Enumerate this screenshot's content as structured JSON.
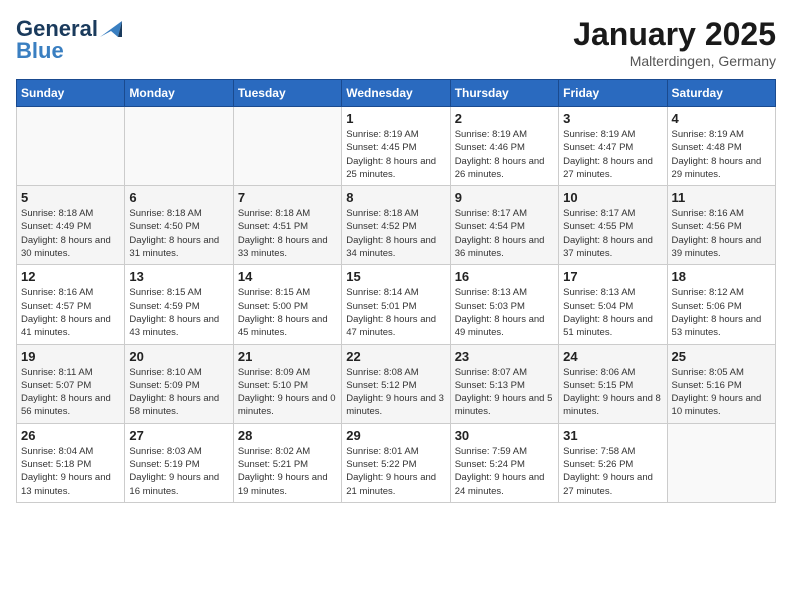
{
  "header": {
    "logo_line1": "General",
    "logo_line2": "Blue",
    "month_year": "January 2025",
    "location": "Malterdingen, Germany"
  },
  "days_of_week": [
    "Sunday",
    "Monday",
    "Tuesday",
    "Wednesday",
    "Thursday",
    "Friday",
    "Saturday"
  ],
  "weeks": [
    [
      {
        "day": "",
        "sunrise": "",
        "sunset": "",
        "daylight": ""
      },
      {
        "day": "",
        "sunrise": "",
        "sunset": "",
        "daylight": ""
      },
      {
        "day": "",
        "sunrise": "",
        "sunset": "",
        "daylight": ""
      },
      {
        "day": "1",
        "sunrise": "Sunrise: 8:19 AM",
        "sunset": "Sunset: 4:45 PM",
        "daylight": "Daylight: 8 hours and 25 minutes."
      },
      {
        "day": "2",
        "sunrise": "Sunrise: 8:19 AM",
        "sunset": "Sunset: 4:46 PM",
        "daylight": "Daylight: 8 hours and 26 minutes."
      },
      {
        "day": "3",
        "sunrise": "Sunrise: 8:19 AM",
        "sunset": "Sunset: 4:47 PM",
        "daylight": "Daylight: 8 hours and 27 minutes."
      },
      {
        "day": "4",
        "sunrise": "Sunrise: 8:19 AM",
        "sunset": "Sunset: 4:48 PM",
        "daylight": "Daylight: 8 hours and 29 minutes."
      }
    ],
    [
      {
        "day": "5",
        "sunrise": "Sunrise: 8:18 AM",
        "sunset": "Sunset: 4:49 PM",
        "daylight": "Daylight: 8 hours and 30 minutes."
      },
      {
        "day": "6",
        "sunrise": "Sunrise: 8:18 AM",
        "sunset": "Sunset: 4:50 PM",
        "daylight": "Daylight: 8 hours and 31 minutes."
      },
      {
        "day": "7",
        "sunrise": "Sunrise: 8:18 AM",
        "sunset": "Sunset: 4:51 PM",
        "daylight": "Daylight: 8 hours and 33 minutes."
      },
      {
        "day": "8",
        "sunrise": "Sunrise: 8:18 AM",
        "sunset": "Sunset: 4:52 PM",
        "daylight": "Daylight: 8 hours and 34 minutes."
      },
      {
        "day": "9",
        "sunrise": "Sunrise: 8:17 AM",
        "sunset": "Sunset: 4:54 PM",
        "daylight": "Daylight: 8 hours and 36 minutes."
      },
      {
        "day": "10",
        "sunrise": "Sunrise: 8:17 AM",
        "sunset": "Sunset: 4:55 PM",
        "daylight": "Daylight: 8 hours and 37 minutes."
      },
      {
        "day": "11",
        "sunrise": "Sunrise: 8:16 AM",
        "sunset": "Sunset: 4:56 PM",
        "daylight": "Daylight: 8 hours and 39 minutes."
      }
    ],
    [
      {
        "day": "12",
        "sunrise": "Sunrise: 8:16 AM",
        "sunset": "Sunset: 4:57 PM",
        "daylight": "Daylight: 8 hours and 41 minutes."
      },
      {
        "day": "13",
        "sunrise": "Sunrise: 8:15 AM",
        "sunset": "Sunset: 4:59 PM",
        "daylight": "Daylight: 8 hours and 43 minutes."
      },
      {
        "day": "14",
        "sunrise": "Sunrise: 8:15 AM",
        "sunset": "Sunset: 5:00 PM",
        "daylight": "Daylight: 8 hours and 45 minutes."
      },
      {
        "day": "15",
        "sunrise": "Sunrise: 8:14 AM",
        "sunset": "Sunset: 5:01 PM",
        "daylight": "Daylight: 8 hours and 47 minutes."
      },
      {
        "day": "16",
        "sunrise": "Sunrise: 8:13 AM",
        "sunset": "Sunset: 5:03 PM",
        "daylight": "Daylight: 8 hours and 49 minutes."
      },
      {
        "day": "17",
        "sunrise": "Sunrise: 8:13 AM",
        "sunset": "Sunset: 5:04 PM",
        "daylight": "Daylight: 8 hours and 51 minutes."
      },
      {
        "day": "18",
        "sunrise": "Sunrise: 8:12 AM",
        "sunset": "Sunset: 5:06 PM",
        "daylight": "Daylight: 8 hours and 53 minutes."
      }
    ],
    [
      {
        "day": "19",
        "sunrise": "Sunrise: 8:11 AM",
        "sunset": "Sunset: 5:07 PM",
        "daylight": "Daylight: 8 hours and 56 minutes."
      },
      {
        "day": "20",
        "sunrise": "Sunrise: 8:10 AM",
        "sunset": "Sunset: 5:09 PM",
        "daylight": "Daylight: 8 hours and 58 minutes."
      },
      {
        "day": "21",
        "sunrise": "Sunrise: 8:09 AM",
        "sunset": "Sunset: 5:10 PM",
        "daylight": "Daylight: 9 hours and 0 minutes."
      },
      {
        "day": "22",
        "sunrise": "Sunrise: 8:08 AM",
        "sunset": "Sunset: 5:12 PM",
        "daylight": "Daylight: 9 hours and 3 minutes."
      },
      {
        "day": "23",
        "sunrise": "Sunrise: 8:07 AM",
        "sunset": "Sunset: 5:13 PM",
        "daylight": "Daylight: 9 hours and 5 minutes."
      },
      {
        "day": "24",
        "sunrise": "Sunrise: 8:06 AM",
        "sunset": "Sunset: 5:15 PM",
        "daylight": "Daylight: 9 hours and 8 minutes."
      },
      {
        "day": "25",
        "sunrise": "Sunrise: 8:05 AM",
        "sunset": "Sunset: 5:16 PM",
        "daylight": "Daylight: 9 hours and 10 minutes."
      }
    ],
    [
      {
        "day": "26",
        "sunrise": "Sunrise: 8:04 AM",
        "sunset": "Sunset: 5:18 PM",
        "daylight": "Daylight: 9 hours and 13 minutes."
      },
      {
        "day": "27",
        "sunrise": "Sunrise: 8:03 AM",
        "sunset": "Sunset: 5:19 PM",
        "daylight": "Daylight: 9 hours and 16 minutes."
      },
      {
        "day": "28",
        "sunrise": "Sunrise: 8:02 AM",
        "sunset": "Sunset: 5:21 PM",
        "daylight": "Daylight: 9 hours and 19 minutes."
      },
      {
        "day": "29",
        "sunrise": "Sunrise: 8:01 AM",
        "sunset": "Sunset: 5:22 PM",
        "daylight": "Daylight: 9 hours and 21 minutes."
      },
      {
        "day": "30",
        "sunrise": "Sunrise: 7:59 AM",
        "sunset": "Sunset: 5:24 PM",
        "daylight": "Daylight: 9 hours and 24 minutes."
      },
      {
        "day": "31",
        "sunrise": "Sunrise: 7:58 AM",
        "sunset": "Sunset: 5:26 PM",
        "daylight": "Daylight: 9 hours and 27 minutes."
      },
      {
        "day": "",
        "sunrise": "",
        "sunset": "",
        "daylight": ""
      }
    ]
  ]
}
